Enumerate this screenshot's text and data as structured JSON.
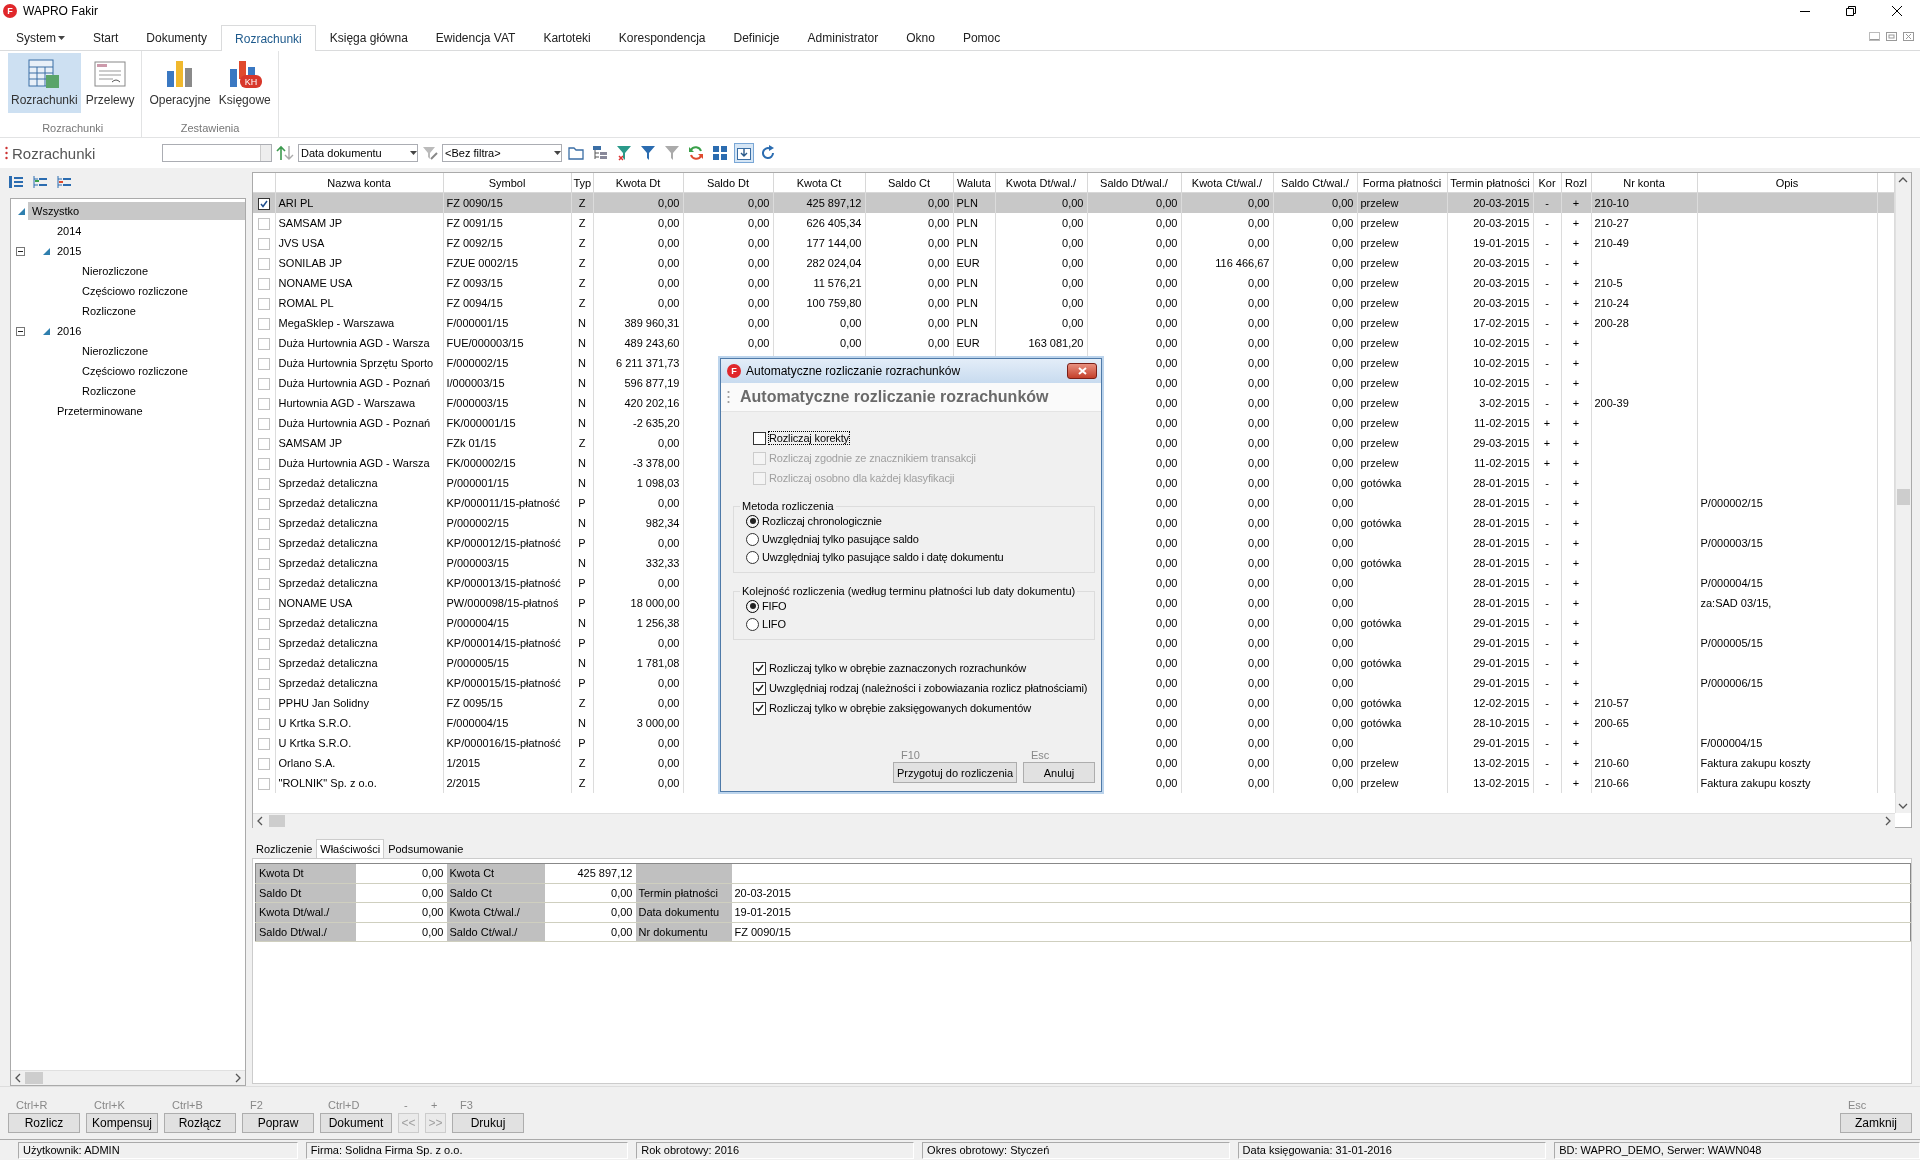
{
  "window": {
    "title": "WAPRO Fakir",
    "logo": "F"
  },
  "menu": [
    {
      "label": "System",
      "dropdown": true,
      "selected": false
    },
    {
      "label": "Start",
      "dropdown": false,
      "selected": false
    },
    {
      "label": "Dokumenty",
      "dropdown": false,
      "selected": false
    },
    {
      "label": "Rozrachunki",
      "dropdown": false,
      "selected": true
    },
    {
      "label": "Księga główna",
      "dropdown": false,
      "selected": false
    },
    {
      "label": "Ewidencja VAT",
      "dropdown": false,
      "selected": false
    },
    {
      "label": "Kartoteki",
      "dropdown": false,
      "selected": false
    },
    {
      "label": "Korespondencja",
      "dropdown": false,
      "selected": false
    },
    {
      "label": "Definicje",
      "dropdown": false,
      "selected": false
    },
    {
      "label": "Administrator",
      "dropdown": false,
      "selected": false
    },
    {
      "label": "Okno",
      "dropdown": false,
      "selected": false
    },
    {
      "label": "Pomoc",
      "dropdown": false,
      "selected": false
    }
  ],
  "ribbon": {
    "groups": [
      {
        "label": "Rozrachunki",
        "buttons": [
          {
            "label": "Rozrachunki",
            "kind": "calculator",
            "selected": true
          },
          {
            "label": "Przelewy",
            "kind": "document",
            "selected": false
          }
        ]
      },
      {
        "label": "Zestawienia",
        "buttons": [
          {
            "label": "Operacyjne",
            "kind": "bars",
            "selected": false
          },
          {
            "label": "Księgowe",
            "kind": "bars-badge",
            "icon_text": "KH",
            "selected": false
          }
        ]
      }
    ]
  },
  "toolbar": {
    "title": "Rozrachunki",
    "sort_field": "Data dokumentu",
    "filter": "<Bez filtra>",
    "tool_buttons": [
      {
        "kind": "folder",
        "pressed": false
      },
      {
        "kind": "tree-grid",
        "pressed": false
      },
      {
        "kind": "filter-clear",
        "pressed": false
      },
      {
        "kind": "filter",
        "pressed": false
      },
      {
        "kind": "filter-off",
        "pressed": false
      },
      {
        "kind": "refresh",
        "pressed": false
      },
      {
        "kind": "grid",
        "pressed": false
      },
      {
        "kind": "download",
        "pressed": true
      },
      {
        "kind": "reload",
        "pressed": false
      }
    ]
  },
  "sidebar": {
    "tree": [
      {
        "label": "Wszystko",
        "selected": true,
        "expanded": true,
        "children": [
          {
            "label": "2014",
            "selected": false
          },
          {
            "label": "2015",
            "selected": false,
            "expanded": true,
            "children": [
              {
                "label": "Nierozliczone",
                "selected": false
              },
              {
                "label": "Częściowo rozliczone",
                "selected": false
              },
              {
                "label": "Rozliczone",
                "selected": false
              }
            ]
          },
          {
            "label": "2016",
            "selected": false,
            "expanded": true,
            "children": [
              {
                "label": "Nierozliczone",
                "selected": false
              },
              {
                "label": "Częściowo rozliczone",
                "selected": false
              },
              {
                "label": "Rozliczone",
                "selected": false
              }
            ]
          },
          {
            "label": "Przeterminowane",
            "selected": false
          }
        ]
      }
    ]
  },
  "table": {
    "columns": [
      "Nazwa konta",
      "Symbol",
      "Typ",
      "Kwota Dt",
      "Saldo Dt",
      "Kwota Ct",
      "Saldo Ct",
      "Waluta",
      "Kwota Dt/wal./",
      "Saldo Dt/wal./",
      "Kwota Ct/wal./",
      "Saldo Ct/wal./",
      "Forma płatności",
      "Termin płatności",
      "Kor",
      "Rozl",
      "Nr konta",
      "Opis"
    ],
    "rows": [
      {
        "checked": true,
        "selected": true,
        "cells": [
          "ARI PL",
          "FZ 0090/15",
          "Z",
          "0,00",
          "0,00",
          "425 897,12",
          "0,00",
          "PLN",
          "0,00",
          "0,00",
          "0,00",
          "0,00",
          "przelew",
          "20-03-2015",
          "-",
          "+",
          "210-10",
          null
        ]
      },
      {
        "checked": false,
        "selected": false,
        "cells": [
          "SAMSAM JP",
          "FZ 0091/15",
          "Z",
          "0,00",
          "0,00",
          "626 405,34",
          "0,00",
          "PLN",
          "0,00",
          "0,00",
          "0,00",
          "0,00",
          "przelew",
          "20-03-2015",
          "-",
          "+",
          "210-27",
          null
        ]
      },
      {
        "checked": false,
        "selected": false,
        "cells": [
          "JVS USA",
          "FZ 0092/15",
          "Z",
          "0,00",
          "0,00",
          "177 144,00",
          "0,00",
          "PLN",
          "0,00",
          "0,00",
          "0,00",
          "0,00",
          "przelew",
          "19-01-2015",
          "-",
          "+",
          "210-49",
          null
        ]
      },
      {
        "checked": false,
        "selected": false,
        "cells": [
          "SONILAB JP",
          "FZUE 0002/15",
          "Z",
          "0,00",
          "0,00",
          "282 024,04",
          "0,00",
          "EUR",
          "0,00",
          "0,00",
          "116 466,67",
          "0,00",
          "przelew",
          "20-03-2015",
          "-",
          "+",
          null,
          null
        ]
      },
      {
        "checked": false,
        "selected": false,
        "cells": [
          "NONAME USA",
          "FZ 0093/15",
          "Z",
          "0,00",
          "0,00",
          "11 576,21",
          "0,00",
          "PLN",
          "0,00",
          "0,00",
          "0,00",
          "0,00",
          "przelew",
          "20-03-2015",
          "-",
          "+",
          "210-5",
          null
        ]
      },
      {
        "checked": false,
        "selected": false,
        "cells": [
          "ROMAL PL",
          "FZ 0094/15",
          "Z",
          "0,00",
          "0,00",
          "100 759,80",
          "0,00",
          "PLN",
          "0,00",
          "0,00",
          "0,00",
          "0,00",
          "przelew",
          "20-03-2015",
          "-",
          "+",
          "210-24",
          null
        ]
      },
      {
        "checked": false,
        "selected": false,
        "cells": [
          "MegaSklep - Warszawa",
          "F/000001/15",
          "N",
          "389 960,31",
          "0,00",
          "0,00",
          "0,00",
          "PLN",
          "0,00",
          "0,00",
          "0,00",
          "0,00",
          "przelew",
          "17-02-2015",
          "-",
          "+",
          "200-28",
          null
        ]
      },
      {
        "checked": false,
        "selected": false,
        "cells": [
          "Duża Hurtownia AGD - Warsza",
          "FUE/000003/15",
          "N",
          "489 243,60",
          "0,00",
          "0,00",
          "0,00",
          "EUR",
          "163 081,20",
          "0,00",
          "0,00",
          "0,00",
          "przelew",
          "10-02-2015",
          "-",
          "+",
          null,
          null
        ]
      },
      {
        "checked": false,
        "selected": false,
        "cells": [
          "Duża Hurtownia Sprzętu Sporto",
          "F/000002/15",
          "N",
          "6 211 371,73",
          null,
          null,
          null,
          null,
          null,
          "0,00",
          "0,00",
          "0,00",
          "przelew",
          "10-02-2015",
          "-",
          "+",
          null,
          null
        ]
      },
      {
        "checked": false,
        "selected": false,
        "cells": [
          "Duża Hurtownia AGD - Poznań",
          "I/000003/15",
          "N",
          "596 877,19",
          null,
          null,
          null,
          null,
          null,
          "0,00",
          "0,00",
          "0,00",
          "przelew",
          "10-02-2015",
          "-",
          "+",
          null,
          null
        ]
      },
      {
        "checked": false,
        "selected": false,
        "cells": [
          "Hurtownia AGD - Warszawa",
          "F/000003/15",
          "N",
          "420 202,16",
          null,
          null,
          null,
          null,
          null,
          "0,00",
          "0,00",
          "0,00",
          "przelew",
          "3-02-2015",
          "-",
          "+",
          "200-39",
          null
        ]
      },
      {
        "checked": false,
        "selected": false,
        "cells": [
          "Duża Hurtownia AGD - Poznań",
          "FK/000001/15",
          "N",
          "-2 635,20",
          null,
          null,
          null,
          null,
          null,
          "0,00",
          "0,00",
          "0,00",
          "przelew",
          "11-02-2015",
          "+",
          "+",
          null,
          null
        ]
      },
      {
        "checked": false,
        "selected": false,
        "cells": [
          "SAMSAM JP",
          "FZk 01/15",
          "Z",
          "0,00",
          null,
          null,
          null,
          null,
          null,
          "0,00",
          "0,00",
          "0,00",
          "przelew",
          "29-03-2015",
          "+",
          "+",
          null,
          null
        ]
      },
      {
        "checked": false,
        "selected": false,
        "cells": [
          "Duża Hurtownia AGD - Warsza",
          "FK/000002/15",
          "N",
          "-3 378,00",
          null,
          null,
          null,
          null,
          null,
          "0,00",
          "0,00",
          "0,00",
          "przelew",
          "11-02-2015",
          "+",
          "+",
          null,
          null
        ]
      },
      {
        "checked": false,
        "selected": false,
        "cells": [
          "Sprzedaż detaliczna",
          "P/000001/15",
          "N",
          "1 098,03",
          null,
          null,
          null,
          null,
          null,
          "0,00",
          "0,00",
          "0,00",
          "gotówka",
          "28-01-2015",
          "-",
          "+",
          null,
          null
        ]
      },
      {
        "checked": false,
        "selected": false,
        "cells": [
          "Sprzedaż detaliczna",
          "KP/000011/15-płatność",
          "P",
          "0,00",
          null,
          null,
          null,
          null,
          null,
          "0,00",
          "0,00",
          "0,00",
          null,
          "28-01-2015",
          "-",
          "+",
          null,
          "P/000002/15"
        ]
      },
      {
        "checked": false,
        "selected": false,
        "cells": [
          "Sprzedaż detaliczna",
          "P/000002/15",
          "N",
          "982,34",
          null,
          null,
          null,
          null,
          null,
          "0,00",
          "0,00",
          "0,00",
          "gotówka",
          "28-01-2015",
          "-",
          "+",
          null,
          null
        ]
      },
      {
        "checked": false,
        "selected": false,
        "cells": [
          "Sprzedaż detaliczna",
          "KP/000012/15-płatność",
          "P",
          "0,00",
          null,
          null,
          null,
          null,
          null,
          "0,00",
          "0,00",
          "0,00",
          null,
          "28-01-2015",
          "-",
          "+",
          null,
          "P/000003/15"
        ]
      },
      {
        "checked": false,
        "selected": false,
        "cells": [
          "Sprzedaż detaliczna",
          "P/000003/15",
          "N",
          "332,33",
          null,
          null,
          null,
          null,
          null,
          "0,00",
          "0,00",
          "0,00",
          "gotówka",
          "28-01-2015",
          "-",
          "+",
          null,
          null
        ]
      },
      {
        "checked": false,
        "selected": false,
        "cells": [
          "Sprzedaż detaliczna",
          "KP/000013/15-płatność",
          "P",
          "0,00",
          null,
          null,
          null,
          null,
          null,
          "0,00",
          "0,00",
          "0,00",
          null,
          "28-01-2015",
          "-",
          "+",
          null,
          "P/000004/15"
        ]
      },
      {
        "checked": false,
        "selected": false,
        "cells": [
          "NONAME USA",
          "PW/000098/15-płatnoś",
          "P",
          "18 000,00",
          null,
          null,
          null,
          null,
          null,
          "0,00",
          "0,00",
          "0,00",
          null,
          "28-01-2015",
          "-",
          "+",
          null,
          "za:SAD 03/15,"
        ]
      },
      {
        "checked": false,
        "selected": false,
        "cells": [
          "Sprzedaż detaliczna",
          "P/000004/15",
          "N",
          "1 256,38",
          null,
          null,
          null,
          null,
          null,
          "0,00",
          "0,00",
          "0,00",
          "gotówka",
          "29-01-2015",
          "-",
          "+",
          null,
          null
        ]
      },
      {
        "checked": false,
        "selected": false,
        "cells": [
          "Sprzedaż detaliczna",
          "KP/000014/15-płatność",
          "P",
          "0,00",
          null,
          null,
          null,
          null,
          null,
          "0,00",
          "0,00",
          "0,00",
          null,
          "29-01-2015",
          "-",
          "+",
          null,
          "P/000005/15"
        ]
      },
      {
        "checked": false,
        "selected": false,
        "cells": [
          "Sprzedaż detaliczna",
          "P/000005/15",
          "N",
          "1 781,08",
          null,
          null,
          null,
          null,
          null,
          "0,00",
          "0,00",
          "0,00",
          "gotówka",
          "29-01-2015",
          "-",
          "+",
          null,
          null
        ]
      },
      {
        "checked": false,
        "selected": false,
        "cells": [
          "Sprzedaż detaliczna",
          "KP/000015/15-płatność",
          "P",
          "0,00",
          null,
          null,
          null,
          null,
          null,
          "0,00",
          "0,00",
          "0,00",
          null,
          "29-01-2015",
          "-",
          "+",
          null,
          "P/000006/15"
        ]
      },
      {
        "checked": false,
        "selected": false,
        "cells": [
          "PPHU Jan Solidny",
          "FZ 0095/15",
          "Z",
          "0,00",
          null,
          null,
          null,
          null,
          null,
          "0,00",
          "0,00",
          "0,00",
          "gotówka",
          "12-02-2015",
          "-",
          "+",
          "210-57",
          null
        ]
      },
      {
        "checked": false,
        "selected": false,
        "cells": [
          "U Krtka S.R.O.",
          "F/000004/15",
          "N",
          "3 000,00",
          null,
          null,
          null,
          null,
          null,
          "0,00",
          "0,00",
          "0,00",
          "gotówka",
          "28-10-2015",
          "-",
          "+",
          "200-65",
          null
        ]
      },
      {
        "checked": false,
        "selected": false,
        "cells": [
          "U Krtka S.R.O.",
          "KP/000016/15-płatność",
          "P",
          "0,00",
          null,
          null,
          null,
          null,
          null,
          "0,00",
          "0,00",
          "0,00",
          null,
          "29-01-2015",
          "-",
          "+",
          null,
          "F/000004/15"
        ]
      },
      {
        "checked": false,
        "selected": false,
        "cells": [
          "Orlano S.A.",
          "1/2015",
          "Z",
          "0,00",
          null,
          null,
          null,
          null,
          null,
          "0,00",
          "0,00",
          "0,00",
          "przelew",
          "13-02-2015",
          "-",
          "+",
          "210-60",
          "Faktura zakupu koszty"
        ]
      },
      {
        "checked": false,
        "selected": false,
        "cells": [
          "\"ROLNIK\" Sp. z o.o.",
          "2/2015",
          "Z",
          "0,00",
          null,
          null,
          null,
          null,
          null,
          "0,00",
          "0,00",
          "0,00",
          "przelew",
          "13-02-2015",
          "-",
          "+",
          "210-66",
          "Faktura zakupu koszty"
        ]
      }
    ]
  },
  "details": {
    "tabs": [
      {
        "label": "Rozliczenie",
        "selected": false
      },
      {
        "label": "Właściwości",
        "selected": true
      },
      {
        "label": "Podsumowanie",
        "selected": false
      }
    ],
    "rows": [
      [
        {
          "label": "Kwota Dt",
          "value": "0,00"
        },
        {
          "label": "Kwota Ct",
          "value": "425 897,12"
        }
      ],
      [
        {
          "label": "Saldo Dt",
          "value": "0,00"
        },
        {
          "label": "Saldo Ct",
          "value": "0,00"
        },
        {
          "label": "Termin płatności",
          "value": "20-03-2015"
        }
      ],
      [
        {
          "label": "Kwota Dt/wal./",
          "value": "0,00"
        },
        {
          "label": "Kwota Ct/wal./",
          "value": "0,00"
        },
        {
          "label": "Data dokumentu",
          "value": "19-01-2015"
        }
      ],
      [
        {
          "label": "Saldo Dt/wal./",
          "value": "0,00"
        },
        {
          "label": "Saldo Ct/wal./",
          "value": "0,00"
        },
        {
          "label": "Nr dokumentu",
          "value": "FZ 0090/15"
        }
      ]
    ]
  },
  "actions": [
    {
      "shortcut": "Ctrl+R",
      "label": "Rozlicz",
      "kind": "text",
      "disabled": false
    },
    {
      "shortcut": "Ctrl+K",
      "label": "Kompensuj",
      "kind": "text",
      "disabled": false
    },
    {
      "shortcut": "Ctrl+B",
      "label": "Rozłącz",
      "kind": "text",
      "disabled": false
    },
    {
      "shortcut": "F2",
      "label": "Popraw",
      "kind": "text",
      "disabled": false
    },
    {
      "shortcut": "Ctrl+D",
      "label": "Dokument",
      "kind": "text",
      "disabled": false
    },
    {
      "shortcut": "-",
      "label": "<<",
      "kind": "nav",
      "disabled": true
    },
    {
      "shortcut": "+",
      "label": ">>",
      "kind": "nav",
      "disabled": true
    },
    {
      "shortcut": "F3",
      "label": "Drukuj",
      "kind": "text",
      "disabled": false
    }
  ],
  "close_action": {
    "shortcut": "Esc",
    "label": "Zamknij"
  },
  "status_bar": [
    "Użytkownik: ADMIN",
    "Firma: Solidna Firma Sp. z o.o.",
    "Rok obrotowy: 2016",
    "Okres obrotowy: Styczeń",
    "Data księgowania: 31-01-2016",
    "BD: WAPRO_DEMO, Serwer: WAWN048"
  ],
  "dialog": {
    "title": "Automatyczne rozliczanie rozrachunków",
    "logo": "F",
    "heading": "Automatyczne rozliczanie rozrachunków",
    "options": [
      {
        "label": "Rozliczaj korekty",
        "checked": false,
        "disabled": false,
        "focused": true
      },
      {
        "label": "Rozliczaj zgodnie ze znacznikiem transakcji",
        "checked": false,
        "disabled": true,
        "focused": false
      },
      {
        "label": "Rozliczaj osobno dla każdej klasyfikacji",
        "checked": false,
        "disabled": true,
        "focused": false
      }
    ],
    "groups": [
      {
        "title": "Metoda rozliczenia",
        "options": [
          {
            "label": "Rozliczaj chronologicznie",
            "selected": true
          },
          {
            "label": "Uwzględniaj tylko pasujące saldo",
            "selected": false
          },
          {
            "label": "Uwzględniaj tylko pasujące saldo i datę dokumentu",
            "selected": false
          }
        ]
      },
      {
        "title": "Kolejność rozliczenia (według terminu płatności lub daty dokumentu)",
        "options": [
          {
            "label": "FIFO",
            "selected": true
          },
          {
            "label": "LIFO",
            "selected": false
          }
        ]
      }
    ],
    "bottom_options": [
      {
        "label": "Rozliczaj tylko w obrębie zaznaczonych rozrachunków",
        "checked": true,
        "disabled": false,
        "focused": false
      },
      {
        "label": "Uwzględniaj rodzaj (należności i zobowiazania rozlicz płatnościami)",
        "checked": true,
        "disabled": false,
        "focused": false
      },
      {
        "label": "Rozliczaj tylko w obrębie zaksięgowanych dokumentów",
        "checked": true,
        "disabled": false,
        "focused": false
      }
    ],
    "buttons": [
      {
        "shortcut": "F10",
        "label": "Przygotuj do rozliczenia",
        "kind": "wide"
      },
      {
        "shortcut": "Esc",
        "label": "Anuluj",
        "kind": "normal"
      }
    ]
  }
}
